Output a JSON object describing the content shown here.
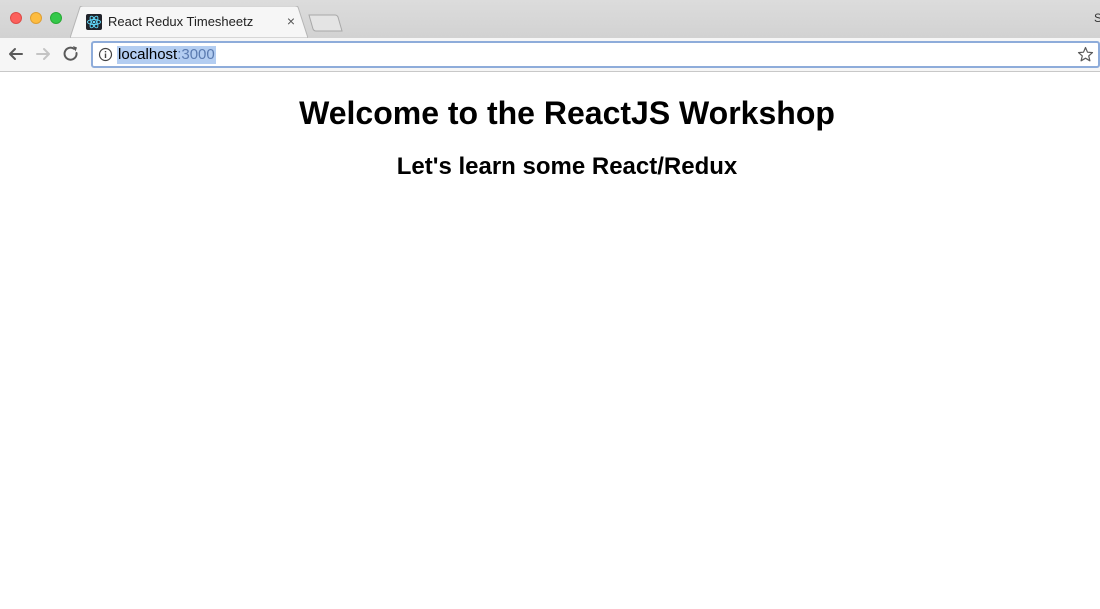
{
  "browser": {
    "tab": {
      "title": "React Redux Timesheetz",
      "favicon": "react-logo-icon",
      "close_glyph": "×"
    },
    "edge_letter": "S",
    "address_bar": {
      "host": "localhost",
      "port": ":3000",
      "info_icon": "info-icon",
      "bookmark_icon": "star-icon"
    },
    "colors": {
      "selection": "#b3cdf1",
      "omnibox_focus": "#8eacda"
    }
  },
  "page": {
    "title": "Welcome to the ReactJS Workshop",
    "subtitle": "Let's learn some React/Redux"
  }
}
